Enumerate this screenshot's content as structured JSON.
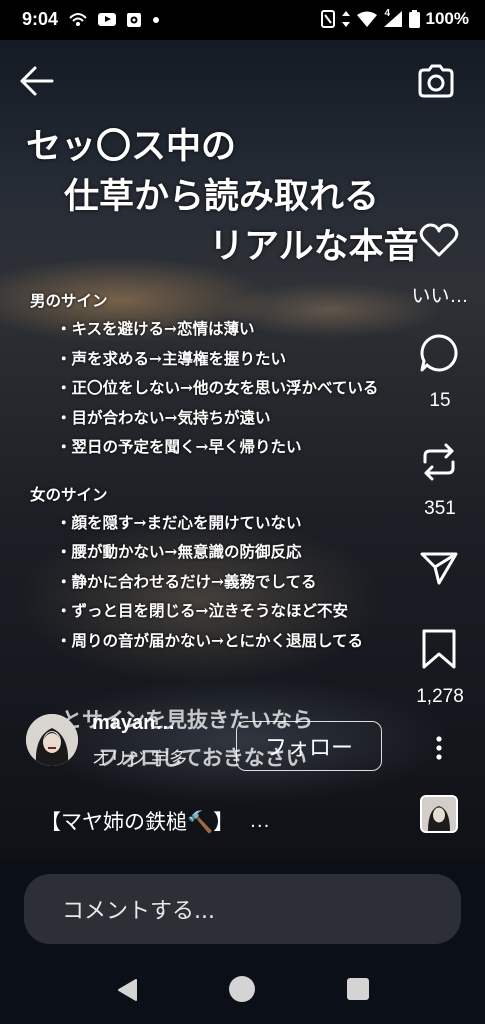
{
  "status_bar": {
    "time": "9:04",
    "battery": "100%",
    "network": "4"
  },
  "overlay": {
    "title_lines": [
      "セッ〇ス中の",
      "仕草から読み取れる",
      "リアルな本音"
    ],
    "male": {
      "heading": "男のサイン",
      "items": [
        "・キスを避ける→恋情は薄い",
        "・声を求める→主導権を握りたい",
        "・正〇位をしない→他の女を思い浮かべている",
        "・目が合わない→気持ちが遠い",
        "・翌日の予定を聞く→早く帰りたい"
      ]
    },
    "female": {
      "heading": "女のサイン",
      "items": [
        "・顔を隠す→まだ心を開けていない",
        "・腰が動かない→無意識の防御反応",
        "・静かに合わせるだけ→義務でしてる",
        "・ずっと目を閉じる→泣きそうなほど不安",
        "・周りの音が届かない→とにかく退屈してる"
      ]
    },
    "caption_line1": "っとサインを見抜きたいなら",
    "caption_line2": "フォロしておきなさい"
  },
  "actions": {
    "like_label": "いい…",
    "comment_count": "15",
    "repost_count": "351",
    "share_label": "",
    "save_count": "1,278"
  },
  "user": {
    "name": "mayan…",
    "sub": "オリジ 宇多",
    "follow_label": "フォロー"
  },
  "post": {
    "caption": "【マヤ姉の鉄槌🔨】",
    "more": "..."
  },
  "comment": {
    "placeholder": "コメントする..."
  },
  "colors": {
    "background": "#0b0f17",
    "input": "#2c3036",
    "text": "#ffffff"
  },
  "icons": {
    "back": "back-arrow-icon",
    "camera": "camera-icon",
    "like": "heart-icon",
    "comment": "comment-icon",
    "repost": "repost-icon",
    "share": "send-icon",
    "save": "bookmark-icon",
    "more": "more-vertical-icon"
  }
}
